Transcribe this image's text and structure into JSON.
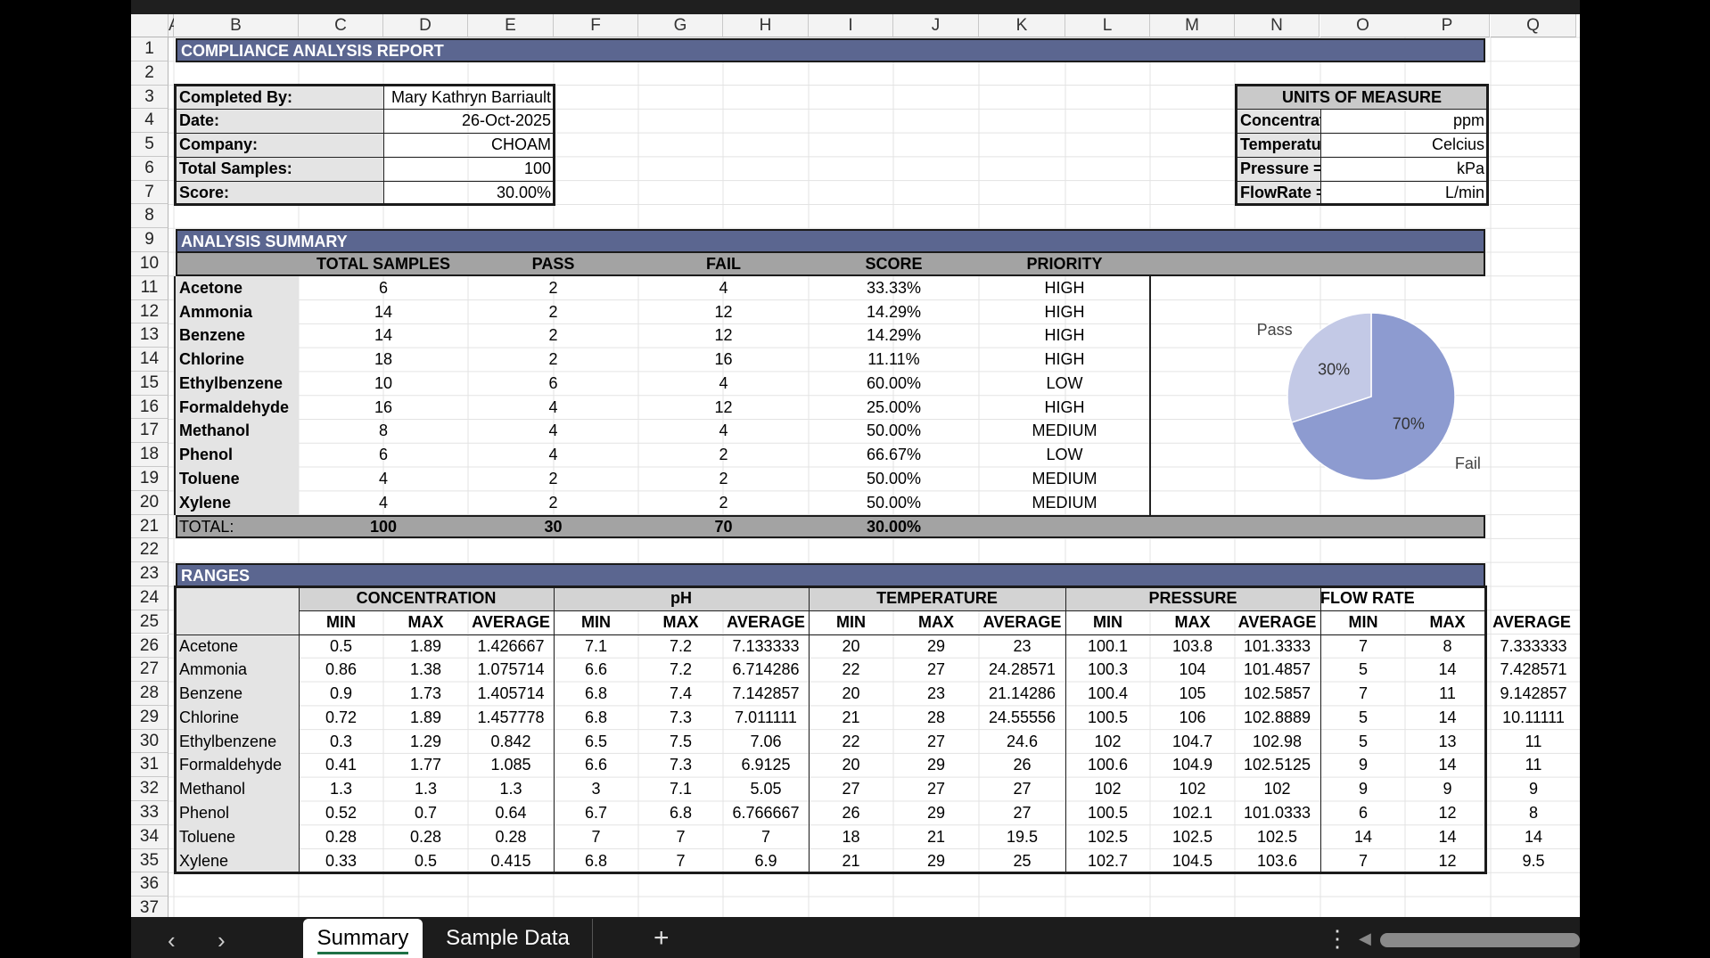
{
  "columns": [
    "A",
    "B",
    "C",
    "D",
    "E",
    "F",
    "G",
    "H",
    "I",
    "J",
    "K",
    "L",
    "M",
    "N",
    "O",
    "P",
    "Q"
  ],
  "rows": [
    "1",
    "2",
    "3",
    "4",
    "5",
    "6",
    "7",
    "8",
    "9",
    "10",
    "11",
    "12",
    "13",
    "14",
    "15",
    "16",
    "17",
    "18",
    "19",
    "20",
    "21",
    "22",
    "23",
    "24",
    "25",
    "26",
    "27",
    "28",
    "29",
    "30",
    "31",
    "32",
    "33",
    "34",
    "35",
    "36",
    "37"
  ],
  "report_title": "COMPLIANCE ANALYSIS REPORT",
  "info": [
    {
      "label": "Completed By:",
      "value": "Mary Kathryn Barriault"
    },
    {
      "label": "Date:",
      "value": "26-Oct-2025"
    },
    {
      "label": "Company:",
      "value": "CHOAM"
    },
    {
      "label": "Total Samples:",
      "value": "100"
    },
    {
      "label": "Score:",
      "value": "30.00%"
    }
  ],
  "units": {
    "title": "UNITS OF MEASURE",
    "rows": [
      {
        "label": "Concentration =",
        "value": "ppm"
      },
      {
        "label": "Temperature =",
        "value": "Celcius"
      },
      {
        "label": "Pressure =",
        "value": "kPa"
      },
      {
        "label": "FlowRate =",
        "value": "L/min"
      }
    ]
  },
  "summary": {
    "title": "ANALYSIS SUMMARY",
    "headers": [
      "TOTAL SAMPLES",
      "PASS",
      "FAIL",
      "SCORE",
      "PRIORITY"
    ],
    "rows": [
      {
        "name": "Acetone",
        "total": "6",
        "pass": "2",
        "fail": "4",
        "score": "33.33%",
        "priority": "HIGH"
      },
      {
        "name": "Ammonia",
        "total": "14",
        "pass": "2",
        "fail": "12",
        "score": "14.29%",
        "priority": "HIGH"
      },
      {
        "name": "Benzene",
        "total": "14",
        "pass": "2",
        "fail": "12",
        "score": "14.29%",
        "priority": "HIGH"
      },
      {
        "name": "Chlorine",
        "total": "18",
        "pass": "2",
        "fail": "16",
        "score": "11.11%",
        "priority": "HIGH"
      },
      {
        "name": "Ethylbenzene",
        "total": "10",
        "pass": "6",
        "fail": "4",
        "score": "60.00%",
        "priority": "LOW"
      },
      {
        "name": "Formaldehyde",
        "total": "16",
        "pass": "4",
        "fail": "12",
        "score": "25.00%",
        "priority": "HIGH"
      },
      {
        "name": "Methanol",
        "total": "8",
        "pass": "4",
        "fail": "4",
        "score": "50.00%",
        "priority": "MEDIUM"
      },
      {
        "name": "Phenol",
        "total": "6",
        "pass": "4",
        "fail": "2",
        "score": "66.67%",
        "priority": "LOW"
      },
      {
        "name": "Toluene",
        "total": "4",
        "pass": "2",
        "fail": "2",
        "score": "50.00%",
        "priority": "MEDIUM"
      },
      {
        "name": "Xylene",
        "total": "4",
        "pass": "2",
        "fail": "2",
        "score": "50.00%",
        "priority": "MEDIUM"
      }
    ],
    "total": {
      "label": "TOTAL:",
      "total": "100",
      "pass": "30",
      "fail": "70",
      "score": "30.00%"
    }
  },
  "chart_data": {
    "type": "pie",
    "labels": [
      "Pass",
      "Fail"
    ],
    "values": [
      30,
      70
    ],
    "data_labels": [
      "30%",
      "70%"
    ],
    "colors": [
      "#c3c9e6",
      "#8d9bd0"
    ]
  },
  "ranges": {
    "title": "RANGES",
    "groups": [
      "CONCENTRATION",
      "pH",
      "TEMPERATURE",
      "PRESSURE",
      "FLOW RATE"
    ],
    "subheaders": [
      "MIN",
      "MAX",
      "AVERAGE"
    ],
    "rows": [
      {
        "name": "Acetone",
        "values": [
          "0.5",
          "1.89",
          "1.426667",
          "7.1",
          "7.2",
          "7.133333",
          "20",
          "29",
          "23",
          "100.1",
          "103.8",
          "101.3333",
          "7",
          "8",
          "7.333333"
        ]
      },
      {
        "name": "Ammonia",
        "values": [
          "0.86",
          "1.38",
          "1.075714",
          "6.6",
          "7.2",
          "6.714286",
          "22",
          "27",
          "24.28571",
          "100.3",
          "104",
          "101.4857",
          "5",
          "14",
          "7.428571"
        ]
      },
      {
        "name": "Benzene",
        "values": [
          "0.9",
          "1.73",
          "1.405714",
          "6.8",
          "7.4",
          "7.142857",
          "20",
          "23",
          "21.14286",
          "100.4",
          "105",
          "102.5857",
          "7",
          "11",
          "9.142857"
        ]
      },
      {
        "name": "Chlorine",
        "values": [
          "0.72",
          "1.89",
          "1.457778",
          "6.8",
          "7.3",
          "7.011111",
          "21",
          "28",
          "24.55556",
          "100.5",
          "106",
          "102.8889",
          "5",
          "14",
          "10.11111"
        ]
      },
      {
        "name": "Ethylbenzene",
        "values": [
          "0.3",
          "1.29",
          "0.842",
          "6.5",
          "7.5",
          "7.06",
          "22",
          "27",
          "24.6",
          "102",
          "104.7",
          "102.98",
          "5",
          "13",
          "11"
        ]
      },
      {
        "name": "Formaldehyde",
        "values": [
          "0.41",
          "1.77",
          "1.085",
          "6.6",
          "7.3",
          "6.9125",
          "20",
          "29",
          "26",
          "100.6",
          "104.9",
          "102.5125",
          "9",
          "14",
          "11"
        ]
      },
      {
        "name": "Methanol",
        "values": [
          "1.3",
          "1.3",
          "1.3",
          "3",
          "7.1",
          "5.05",
          "27",
          "27",
          "27",
          "102",
          "102",
          "102",
          "9",
          "9",
          "9"
        ]
      },
      {
        "name": "Phenol",
        "values": [
          "0.52",
          "0.7",
          "0.64",
          "6.7",
          "6.8",
          "6.766667",
          "26",
          "29",
          "27",
          "100.5",
          "102.1",
          "101.0333",
          "6",
          "12",
          "8"
        ]
      },
      {
        "name": "Toluene",
        "values": [
          "0.28",
          "0.28",
          "0.28",
          "7",
          "7",
          "7",
          "18",
          "21",
          "19.5",
          "102.5",
          "102.5",
          "102.5",
          "14",
          "14",
          "14"
        ]
      },
      {
        "name": "Xylene",
        "values": [
          "0.33",
          "0.5",
          "0.415",
          "6.8",
          "7",
          "6.9",
          "21",
          "29",
          "25",
          "102.7",
          "104.5",
          "103.6",
          "7",
          "12",
          "9.5"
        ]
      }
    ]
  },
  "tabs": [
    {
      "label": "Summary",
      "active": true
    },
    {
      "label": "Sample Data",
      "active": false
    }
  ],
  "tab_nav": {
    "prev": "‹",
    "next": "›",
    "add": "+",
    "more": "⋮"
  }
}
